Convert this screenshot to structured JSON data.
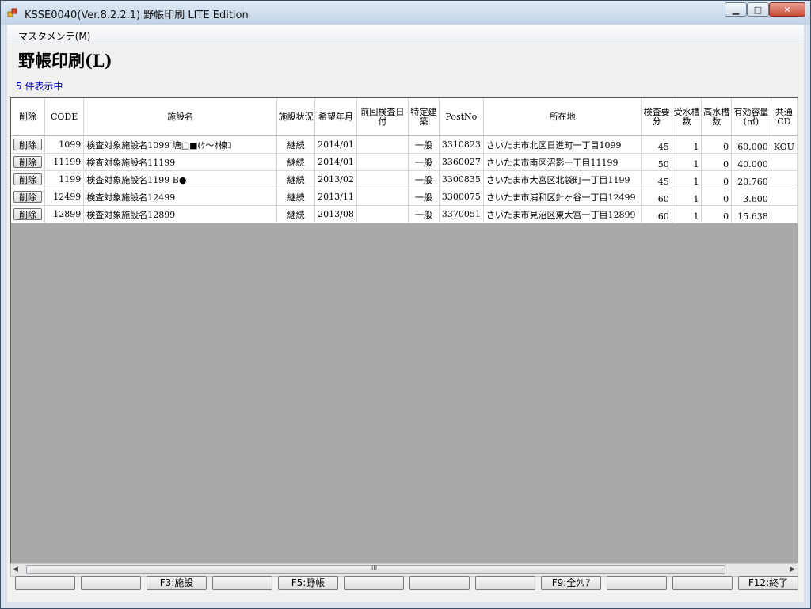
{
  "window": {
    "title": "KSSE0040(Ver.8.2.2.1) 野帳印刷 LITE Edition",
    "minimize_symbol": "▁",
    "maximize_symbol": "□",
    "close_symbol": "✕"
  },
  "menu": {
    "maintenance_label": "マスタメンテ(M)"
  },
  "page_title": "野帳印刷(L)",
  "count_label": "5 件表示中",
  "grid": {
    "headers": {
      "delete": "削除",
      "code": "CODE",
      "name": "施設名",
      "status": "施設状況",
      "desired_ym": "希望年月",
      "prev_date": "前回検査日付",
      "special": "特定建築",
      "postno": "PostNo",
      "address": "所在地",
      "inspection": "検査要分",
      "recv_tanks": "受水槽数",
      "high_tanks": "高水槽数",
      "capacity": "有効容量(㎥)",
      "shared": "共通CD"
    },
    "rows": [
      {
        "delete": "削除",
        "code": "1099",
        "name": "検査対象施設名1099 塘□■(ｹ～ｵ楝ｺ",
        "status": "継続",
        "desired_ym": "2014/01",
        "prev_date": "",
        "special": "一般",
        "postno": "3310823",
        "address": "さいたま市北区日進町一丁目1099",
        "inspection": "45",
        "recv_tanks": "1",
        "high_tanks": "0",
        "capacity": "60.000",
        "shared": "KOU"
      },
      {
        "delete": "削除",
        "code": "11199",
        "name": "検査対象施設名11199",
        "status": "継続",
        "desired_ym": "2014/01",
        "prev_date": "",
        "special": "一般",
        "postno": "3360027",
        "address": "さいたま市南区沼影一丁目11199",
        "inspection": "50",
        "recv_tanks": "1",
        "high_tanks": "0",
        "capacity": "40.000",
        "shared": ""
      },
      {
        "delete": "削除",
        "code": "1199",
        "name": "検査対象施設名1199 B●",
        "status": "継続",
        "desired_ym": "2013/02",
        "prev_date": "",
        "special": "一般",
        "postno": "3300835",
        "address": "さいたま市大宮区北袋町一丁目1199",
        "inspection": "45",
        "recv_tanks": "1",
        "high_tanks": "0",
        "capacity": "20.760",
        "shared": ""
      },
      {
        "delete": "削除",
        "code": "12499",
        "name": "検査対象施設名12499",
        "status": "継続",
        "desired_ym": "2013/11",
        "prev_date": "",
        "special": "一般",
        "postno": "3300075",
        "address": "さいたま市浦和区針ヶ谷一丁目12499",
        "inspection": "60",
        "recv_tanks": "1",
        "high_tanks": "0",
        "capacity": "3.600",
        "shared": ""
      },
      {
        "delete": "削除",
        "code": "12899",
        "name": "検査対象施設名12899",
        "status": "継続",
        "desired_ym": "2013/08",
        "prev_date": "",
        "special": "一般",
        "postno": "3370051",
        "address": "さいたま市見沼区東大宮一丁目12899",
        "inspection": "60",
        "recv_tanks": "1",
        "high_tanks": "0",
        "capacity": "15.638",
        "shared": ""
      }
    ]
  },
  "scrollbar": {
    "left_arrow": "◀",
    "right_arrow": "▶",
    "grip": "III"
  },
  "function_keys": [
    {
      "label": ""
    },
    {
      "label": ""
    },
    {
      "label": "F3:施設"
    },
    {
      "label": ""
    },
    {
      "label": "F5:野帳"
    },
    {
      "label": ""
    },
    {
      "label": ""
    },
    {
      "label": ""
    },
    {
      "label": "F9:全ｸﾘｱ"
    },
    {
      "label": ""
    },
    {
      "label": ""
    },
    {
      "label": "F12:終了"
    }
  ]
}
